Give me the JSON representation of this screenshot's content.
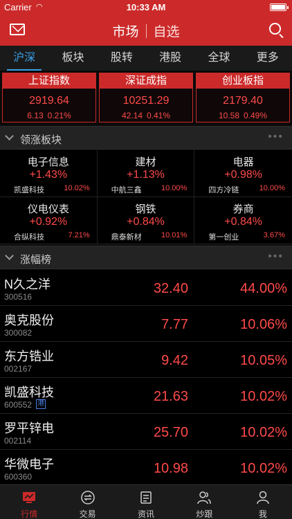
{
  "status_bar": {
    "carrier": "Carrier",
    "time": "10:33 AM"
  },
  "nav": {
    "title": "市场",
    "alt_title": "自选"
  },
  "tabs": [
    "沪深",
    "板块",
    "股转",
    "港股",
    "全球",
    "更多"
  ],
  "indices": [
    {
      "name": "上证指数",
      "price": "2919.64",
      "change": "6.13",
      "pct": "0.21%"
    },
    {
      "name": "深证成指",
      "price": "10251.29",
      "change": "42.14",
      "pct": "0.41%"
    },
    {
      "name": "创业板指",
      "price": "2179.40",
      "change": "10.58",
      "pct": "0.49%"
    }
  ],
  "sectors_section": {
    "title": "领涨板块"
  },
  "sectors": [
    {
      "name": "电子信息",
      "pct": "+1.43%",
      "leader": "凯盛科技",
      "leader_pct": "10.02%"
    },
    {
      "name": "建材",
      "pct": "+1.13%",
      "leader": "中航三鑫",
      "leader_pct": "10.00%"
    },
    {
      "name": "电器",
      "pct": "+0.98%",
      "leader": "四方冷链",
      "leader_pct": "10.00%"
    },
    {
      "name": "仪电仪表",
      "pct": "+0.92%",
      "leader": "合纵科技",
      "leader_pct": "7.21%"
    },
    {
      "name": "钢铁",
      "pct": "+0.84%",
      "leader": "鼎泰新材",
      "leader_pct": "10.01%"
    },
    {
      "name": "券商",
      "pct": "+0.84%",
      "leader": "第一创业",
      "leader_pct": "3.67%"
    }
  ],
  "gainers_section": {
    "title": "涨幅榜"
  },
  "stocks": [
    {
      "name": "N久之洋",
      "code": "300516",
      "price": "32.40",
      "pct": "44.00%",
      "badge": ""
    },
    {
      "name": "奥克股份",
      "code": "300082",
      "price": "7.77",
      "pct": "10.06%",
      "badge": ""
    },
    {
      "name": "东方锆业",
      "code": "002167",
      "price": "9.42",
      "pct": "10.05%",
      "badge": ""
    },
    {
      "name": "凯盛科技",
      "code": "600552",
      "price": "21.63",
      "pct": "10.02%",
      "badge": "港"
    },
    {
      "name": "罗平锌电",
      "code": "002114",
      "price": "25.70",
      "pct": "10.02%",
      "badge": ""
    },
    {
      "name": "华微电子",
      "code": "600360",
      "price": "10.98",
      "pct": "10.02%",
      "badge": ""
    }
  ],
  "bottom_tabs": [
    {
      "label": "行情",
      "icon": "market-icon"
    },
    {
      "label": "交易",
      "icon": "trade-icon"
    },
    {
      "label": "资讯",
      "icon": "news-icon"
    },
    {
      "label": "炒跟",
      "icon": "follow-icon"
    },
    {
      "label": "我",
      "icon": "profile-icon"
    }
  ],
  "colors": {
    "brand": "#cc2a2a",
    "up": "#ff4a4a",
    "tab_active": "#3aa0e8"
  }
}
